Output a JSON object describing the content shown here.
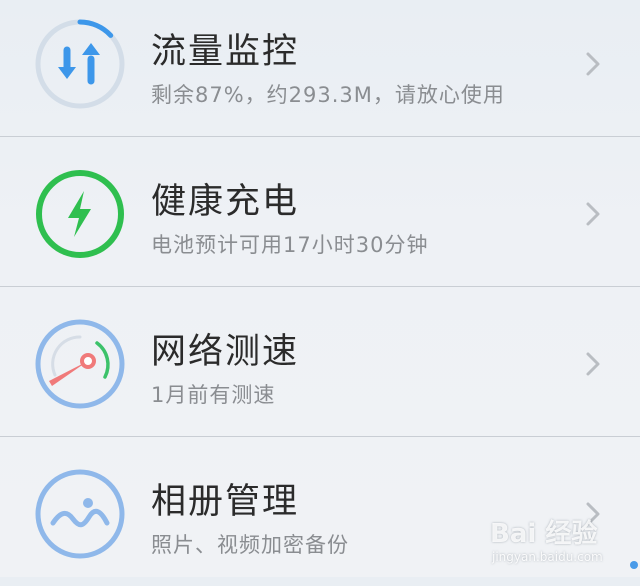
{
  "items": [
    {
      "title": "流量监控",
      "subtitle": "剩余87%，约293.3M，请放心使用",
      "icon": "data-traffic-icon",
      "color": "#3d97ea",
      "remaining_percent": 87
    },
    {
      "title": "健康充电",
      "subtitle": "电池预计可用17小时30分钟",
      "icon": "lightning-icon",
      "color": "#2fbf4f"
    },
    {
      "title": "网络测速",
      "subtitle": "1月前有测速",
      "icon": "speedometer-icon",
      "color": "#8fb8ea"
    },
    {
      "title": "相册管理",
      "subtitle": "照片、视频加密备份",
      "icon": "gallery-icon",
      "color": "#8fb8ea"
    }
  ],
  "watermark": {
    "text": "Bai 经验",
    "sub": "jingyan.baidu.com"
  }
}
